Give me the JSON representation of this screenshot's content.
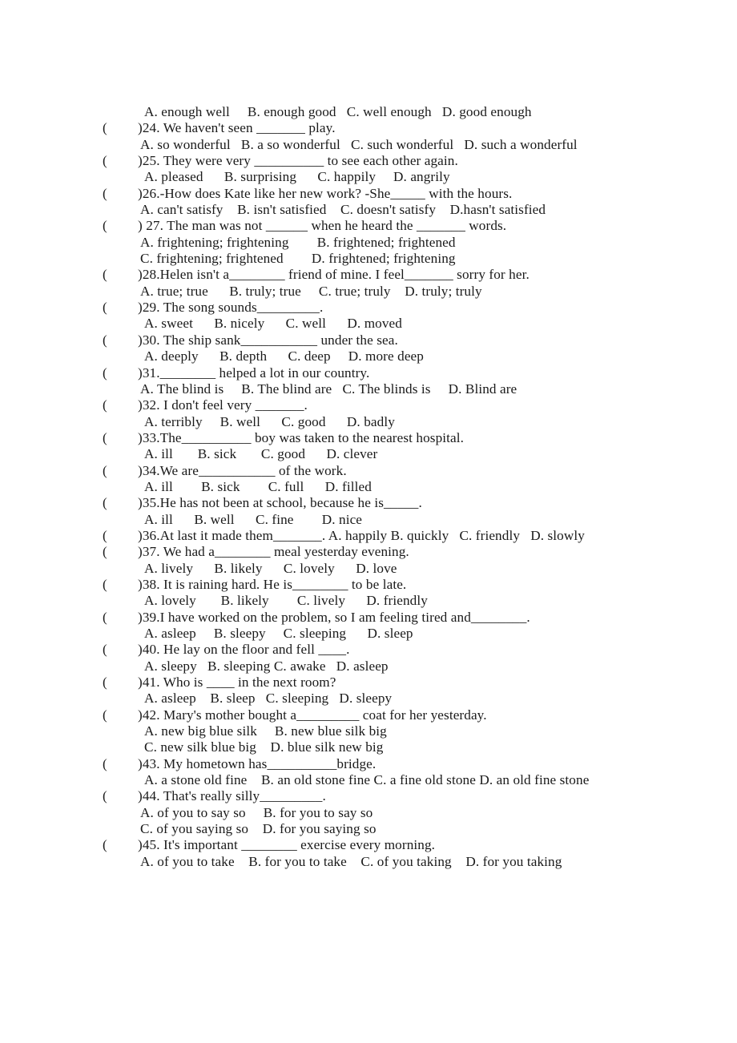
{
  "document": {
    "type": "english-grammar-worksheet",
    "font_color": "#1a1a1a",
    "background": "#ffffff",
    "open_paren": "(",
    "close_paren": ")"
  },
  "lines": [
    {
      "kind": "option",
      "indent": "deep",
      "text": "A. enough well     B. enough good   C. well enough   D. good enough"
    },
    {
      "kind": "question",
      "text": ")24. We haven't seen _______ play."
    },
    {
      "kind": "option",
      "indent": "normal",
      "text": "A. so wonderful   B. a so wonderful   C. such wonderful   D. such a wonderful"
    },
    {
      "kind": "question",
      "text": ")25. They were very __________ to see each other again."
    },
    {
      "kind": "option",
      "indent": "deep",
      "text": "A. pleased      B. surprising      C. happily     D. angrily"
    },
    {
      "kind": "question",
      "text": ")26.-How does Kate like her new work? -She_____ with the hours."
    },
    {
      "kind": "option",
      "indent": "normal",
      "text": "A. can't satisfy    B. isn't satisfied    C. doesn't satisfy    D.hasn't satisfied"
    },
    {
      "kind": "question",
      "text": ") 27. The man was not ______ when he heard the _______ words."
    },
    {
      "kind": "option",
      "indent": "normal",
      "text": "A. frightening; frightening        B. frightened; frightened"
    },
    {
      "kind": "option",
      "indent": "normal",
      "text": "C. frightening; frightened        D. frightened; frightening"
    },
    {
      "kind": "question",
      "text": ")28.Helen isn't a________ friend of mine. I feel_______ sorry for her."
    },
    {
      "kind": "option",
      "indent": "normal",
      "text": "A. true; true      B. truly; true     C. true; truly    D. truly; truly"
    },
    {
      "kind": "question",
      "text": ")29. The song sounds_________."
    },
    {
      "kind": "option",
      "indent": "deep",
      "text": "A. sweet      B. nicely      C. well      D. moved"
    },
    {
      "kind": "question",
      "text": ")30. The ship sank___________ under the sea."
    },
    {
      "kind": "option",
      "indent": "deep",
      "text": "A. deeply      B. depth      C. deep     D. more deep"
    },
    {
      "kind": "question",
      "text": ")31.________ helped a lot in our country."
    },
    {
      "kind": "option",
      "indent": "normal",
      "text": "A. The blind is     B. The blind are   C. The blinds is     D. Blind are"
    },
    {
      "kind": "question",
      "text": ")32. I don't feel very _______."
    },
    {
      "kind": "option",
      "indent": "deep",
      "text": "A. terribly     B. well      C. good      D. badly"
    },
    {
      "kind": "question",
      "text": ")33.The__________ boy was taken to the nearest hospital."
    },
    {
      "kind": "option",
      "indent": "deep",
      "text": "A. ill       B. sick       C. good      D. clever"
    },
    {
      "kind": "question",
      "text": ")34.We are___________ of the work."
    },
    {
      "kind": "option",
      "indent": "deep",
      "text": "A. ill        B. sick        C. full      D. filled"
    },
    {
      "kind": "question",
      "text": ")35.He has not been at school, because he is_____."
    },
    {
      "kind": "option",
      "indent": "deep",
      "text": "A. ill      B. well      C. fine        D. nice"
    },
    {
      "kind": "question",
      "text": ")36.At last it made them_______. A. happily B. quickly   C. friendly   D. slowly"
    },
    {
      "kind": "question",
      "text": ")37. We had a________ meal yesterday evening."
    },
    {
      "kind": "option",
      "indent": "deep",
      "text": "A. lively      B. likely      C. lovely      D. love"
    },
    {
      "kind": "question",
      "text": ")38. It is raining hard. He is________ to be late."
    },
    {
      "kind": "option",
      "indent": "deep",
      "text": "A. lovely       B. likely        C. lively      D. friendly"
    },
    {
      "kind": "question",
      "text": ")39.I have worked on the problem, so I am feeling tired and________."
    },
    {
      "kind": "option",
      "indent": "deep",
      "text": "A. asleep     B. sleepy     C. sleeping      D. sleep"
    },
    {
      "kind": "question",
      "text": ")40. He lay on the floor and fell ____."
    },
    {
      "kind": "option",
      "indent": "deep",
      "text": "A. sleepy   B. sleeping C. awake   D. asleep"
    },
    {
      "kind": "question",
      "text": ")41. Who is ____ in the next room?"
    },
    {
      "kind": "option",
      "indent": "deep",
      "text": "A. asleep    B. sleep   C. sleeping   D. sleepy"
    },
    {
      "kind": "question",
      "text": ")42. Mary's mother bought a_________ coat for her yesterday."
    },
    {
      "kind": "option",
      "indent": "deep",
      "text": "A. new big blue silk     B. new blue silk big"
    },
    {
      "kind": "option",
      "indent": "deep",
      "text": "C. new silk blue big    D. blue silk new big"
    },
    {
      "kind": "question",
      "text": ")43. My hometown has__________bridge."
    },
    {
      "kind": "option",
      "indent": "deep",
      "text": "A. a stone old fine    B. an old stone fine C. a fine old stone D. an old fine stone"
    },
    {
      "kind": "question",
      "text": ")44. That's really silly_________."
    },
    {
      "kind": "option",
      "indent": "normal",
      "text": "A. of you to say so     B. for you to say so"
    },
    {
      "kind": "option",
      "indent": "normal",
      "text": "C. of you saying so    D. for you saying so"
    },
    {
      "kind": "question",
      "text": ")45. It's important ________ exercise every morning."
    },
    {
      "kind": "option",
      "indent": "normal",
      "text": "A. of you to take    B. for you to take    C. of you taking    D. for you taking"
    }
  ]
}
